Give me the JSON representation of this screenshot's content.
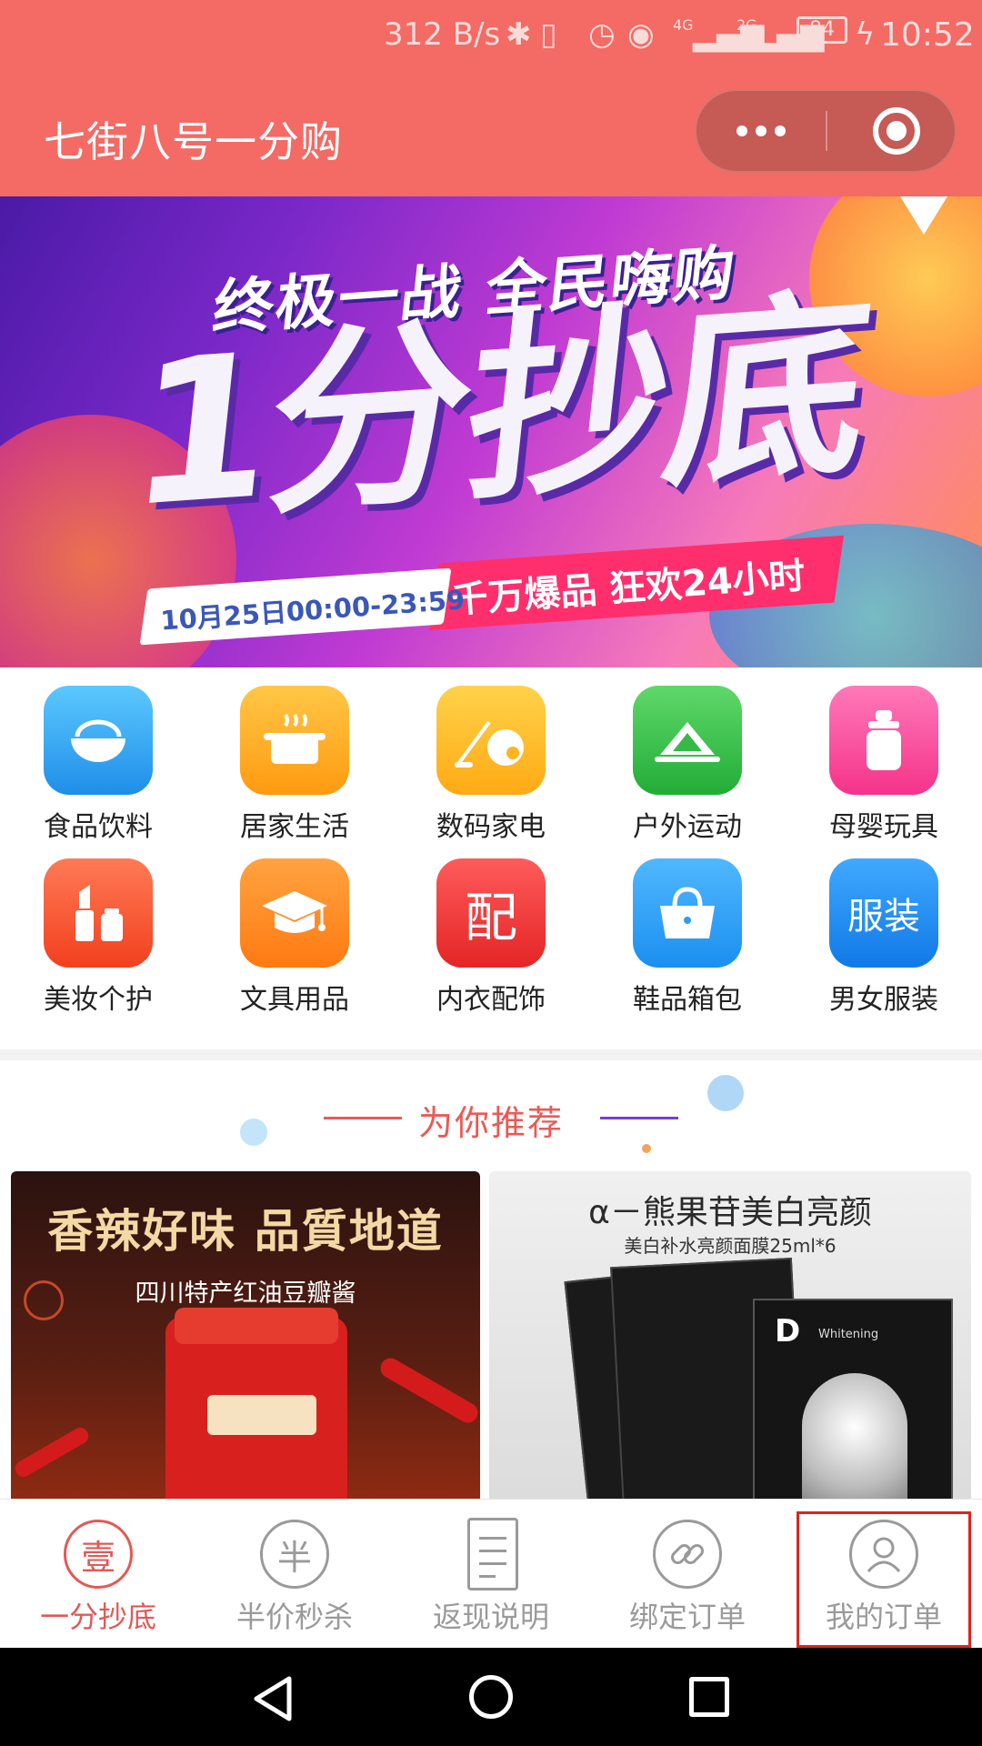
{
  "status_bar": {
    "net_speed": "312 B/s",
    "signal_1": "4G",
    "signal_2": "2G",
    "battery": "84",
    "time": "10:52"
  },
  "title_bar": {
    "title": "七街八号一分购"
  },
  "banner": {
    "line1": "终极一战 全民嗨购",
    "line2": "1分抄底",
    "date": "10月25日00:00-23:59",
    "tagline": "千万爆品 狂欢24小时"
  },
  "categories": [
    {
      "label": "食品饮料",
      "color": "#2fa8f0",
      "icon": "rice-bowl-icon"
    },
    {
      "label": "居家生活",
      "color": "#ffb020",
      "icon": "cooking-pot-icon"
    },
    {
      "label": "数码家电",
      "color": "#ffbf24",
      "icon": "vacuum-cleaner-icon"
    },
    {
      "label": "户外运动",
      "color": "#3cc24a",
      "icon": "tent-icon"
    },
    {
      "label": "母婴玩具",
      "color": "#ff4fa0",
      "icon": "baby-bottle-icon"
    },
    {
      "label": "美妆个护",
      "color": "#ff5a3a",
      "icon": "lipstick-icon"
    },
    {
      "label": "文具用品",
      "color": "#ff8a1e",
      "icon": "graduation-cap-icon"
    },
    {
      "label": "内衣配饰",
      "color": "#f23b3b",
      "icon": "pei-character-icon",
      "glyph": "配"
    },
    {
      "label": "鞋品箱包",
      "color": "#2b9ff0",
      "icon": "handbag-icon"
    },
    {
      "label": "男女服装",
      "color": "#1e8cf0",
      "icon": "clothing-text-icon",
      "glyph": "服装"
    }
  ],
  "recommend": {
    "title": "为你推荐"
  },
  "products": [
    {
      "title": "香辣好味 品質地道",
      "subtitle": "四川特产红油豆瓣酱"
    },
    {
      "title": "α－熊果苷美白亮颜",
      "subtitle": "美白补水亮颜面膜25ml*6",
      "brand_mark": "D",
      "pack_text": "Whitening"
    }
  ],
  "tabs": [
    {
      "label": "一分抄底",
      "glyph": "壹",
      "icon": "yi-circle-icon",
      "active": true
    },
    {
      "label": "半价秒杀",
      "glyph": "半",
      "icon": "ban-circle-icon",
      "active": false
    },
    {
      "label": "返现说明",
      "icon": "document-icon",
      "active": false
    },
    {
      "label": "绑定订单",
      "glyph": "🔗",
      "icon": "link-icon",
      "active": false
    },
    {
      "label": "我的订单",
      "icon": "user-icon",
      "active": false
    }
  ],
  "colors": {
    "header": "#f46a64",
    "accent": "#e05a57",
    "highlight_box": "#e0231e"
  }
}
